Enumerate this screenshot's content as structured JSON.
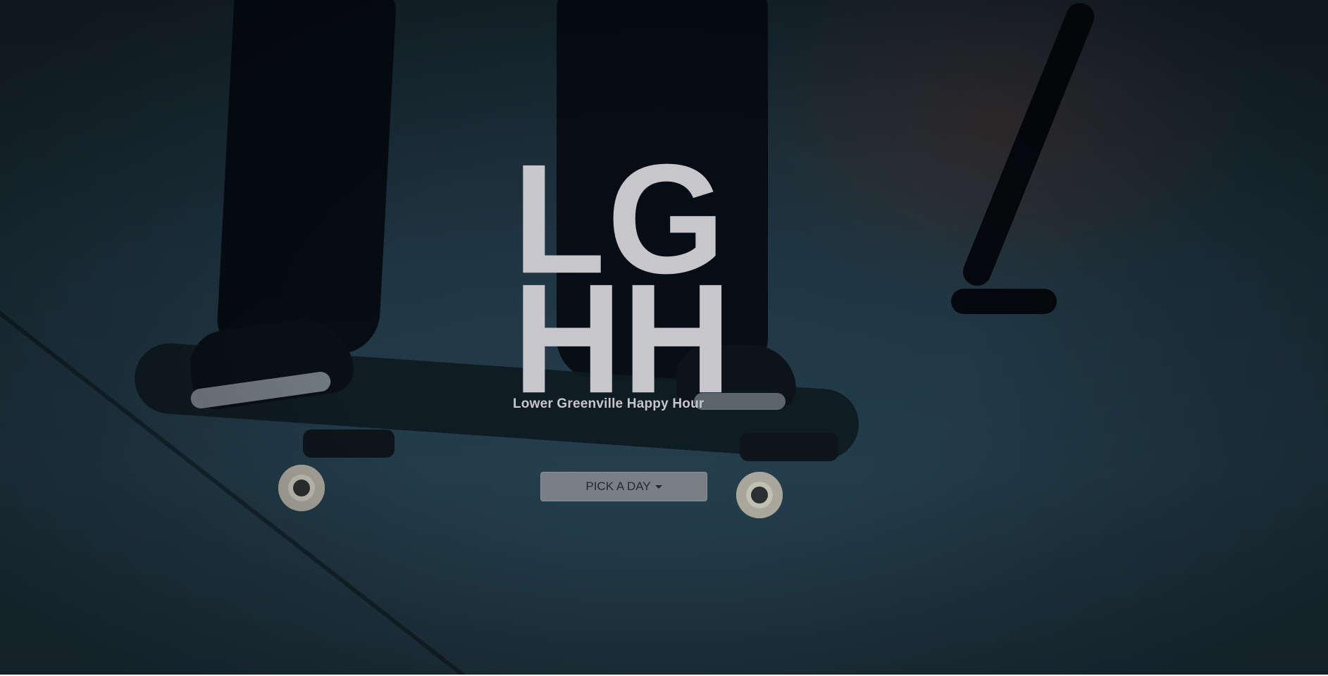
{
  "logo": {
    "line1": [
      "L",
      "G"
    ],
    "line2": [
      "H",
      "H"
    ],
    "tagline": "Lower Greenville Happy Hour"
  },
  "day_picker": {
    "label": "PICK A DAY",
    "icon": "caret-down-icon"
  },
  "colors": {
    "logo": "#c6c6cb",
    "button_bg": "#7e8387",
    "button_text": "#1f2a30",
    "background": "#1e3440"
  }
}
